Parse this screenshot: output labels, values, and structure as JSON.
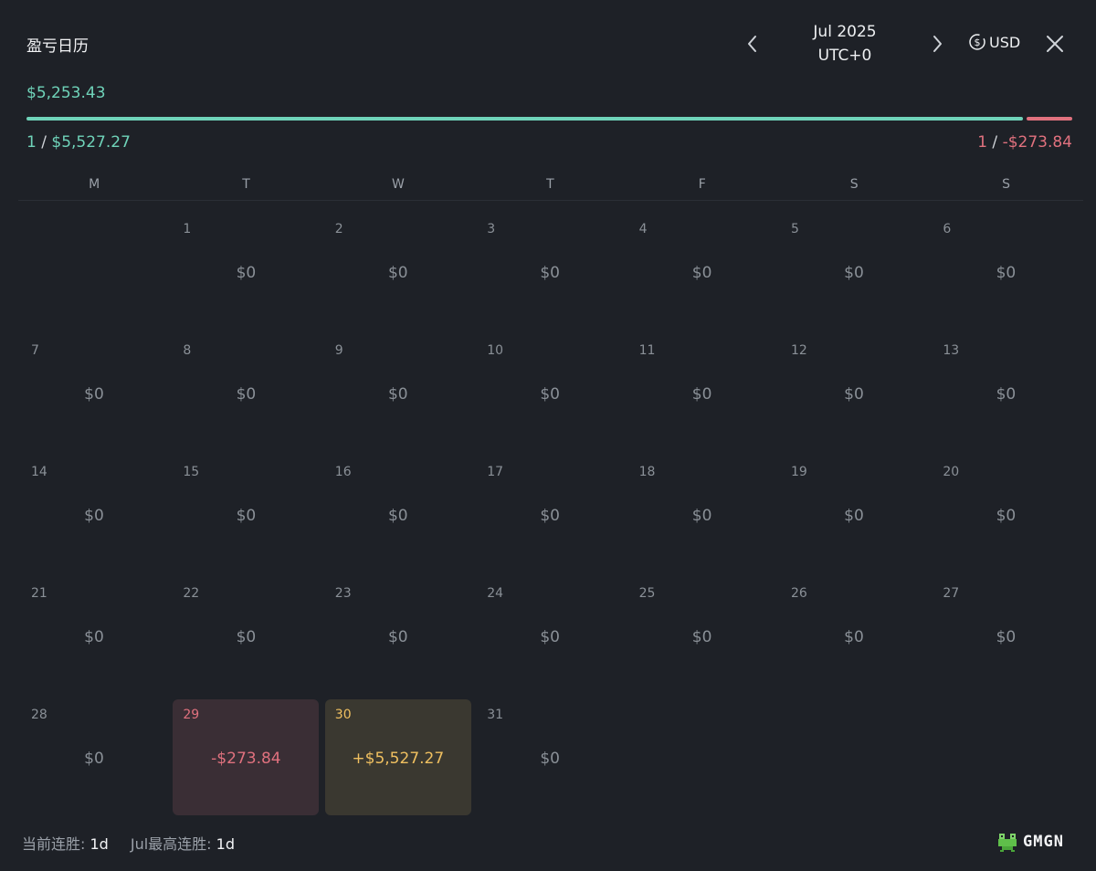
{
  "header": {
    "title": "盈亏日历",
    "month": "Jul 2025",
    "timezone": "UTC+0",
    "currency": "USD"
  },
  "summary": {
    "total": "$5,253.43",
    "win_count": "1",
    "win_amount": "$5,527.27",
    "loss_count": "1",
    "loss_amount": "-$273.84",
    "win_fraction": 0.953
  },
  "weekdays": [
    "M",
    "T",
    "W",
    "T",
    "F",
    "S",
    "S"
  ],
  "days": [
    {
      "day": "1",
      "value": "$0",
      "state": "neutral"
    },
    {
      "day": "2",
      "value": "$0",
      "state": "neutral"
    },
    {
      "day": "3",
      "value": "$0",
      "state": "neutral"
    },
    {
      "day": "4",
      "value": "$0",
      "state": "neutral"
    },
    {
      "day": "5",
      "value": "$0",
      "state": "neutral"
    },
    {
      "day": "6",
      "value": "$0",
      "state": "neutral"
    },
    {
      "day": "7",
      "value": "$0",
      "state": "neutral"
    },
    {
      "day": "8",
      "value": "$0",
      "state": "neutral"
    },
    {
      "day": "9",
      "value": "$0",
      "state": "neutral"
    },
    {
      "day": "10",
      "value": "$0",
      "state": "neutral"
    },
    {
      "day": "11",
      "value": "$0",
      "state": "neutral"
    },
    {
      "day": "12",
      "value": "$0",
      "state": "neutral"
    },
    {
      "day": "13",
      "value": "$0",
      "state": "neutral"
    },
    {
      "day": "14",
      "value": "$0",
      "state": "neutral"
    },
    {
      "day": "15",
      "value": "$0",
      "state": "neutral"
    },
    {
      "day": "16",
      "value": "$0",
      "state": "neutral"
    },
    {
      "day": "17",
      "value": "$0",
      "state": "neutral"
    },
    {
      "day": "18",
      "value": "$0",
      "state": "neutral"
    },
    {
      "day": "19",
      "value": "$0",
      "state": "neutral"
    },
    {
      "day": "20",
      "value": "$0",
      "state": "neutral"
    },
    {
      "day": "21",
      "value": "$0",
      "state": "neutral"
    },
    {
      "day": "22",
      "value": "$0",
      "state": "neutral"
    },
    {
      "day": "23",
      "value": "$0",
      "state": "neutral"
    },
    {
      "day": "24",
      "value": "$0",
      "state": "neutral"
    },
    {
      "day": "25",
      "value": "$0",
      "state": "neutral"
    },
    {
      "day": "26",
      "value": "$0",
      "state": "neutral"
    },
    {
      "day": "27",
      "value": "$0",
      "state": "neutral"
    },
    {
      "day": "28",
      "value": "$0",
      "state": "neutral"
    },
    {
      "day": "29",
      "value": "-$273.84",
      "state": "loss"
    },
    {
      "day": "30",
      "value": "+$5,527.27",
      "state": "gain"
    },
    {
      "day": "31",
      "value": "$0",
      "state": "neutral"
    }
  ],
  "footer": {
    "current_streak_label": "当前连胜:",
    "current_streak_value": "1d",
    "best_streak_label": "Jul最高连胜:",
    "best_streak_value": "1d"
  },
  "brand": {
    "name": "GMGN"
  },
  "colors": {
    "win": "#6fd3b9",
    "loss": "#e0717e",
    "gain_highlight": "#f0c060",
    "background": "#1e2127"
  },
  "icons": {
    "prev": "chevron-left-icon",
    "next": "chevron-right-icon",
    "currency": "dollar-circle-icon",
    "close": "close-icon",
    "logo": "frog-logo-icon"
  }
}
